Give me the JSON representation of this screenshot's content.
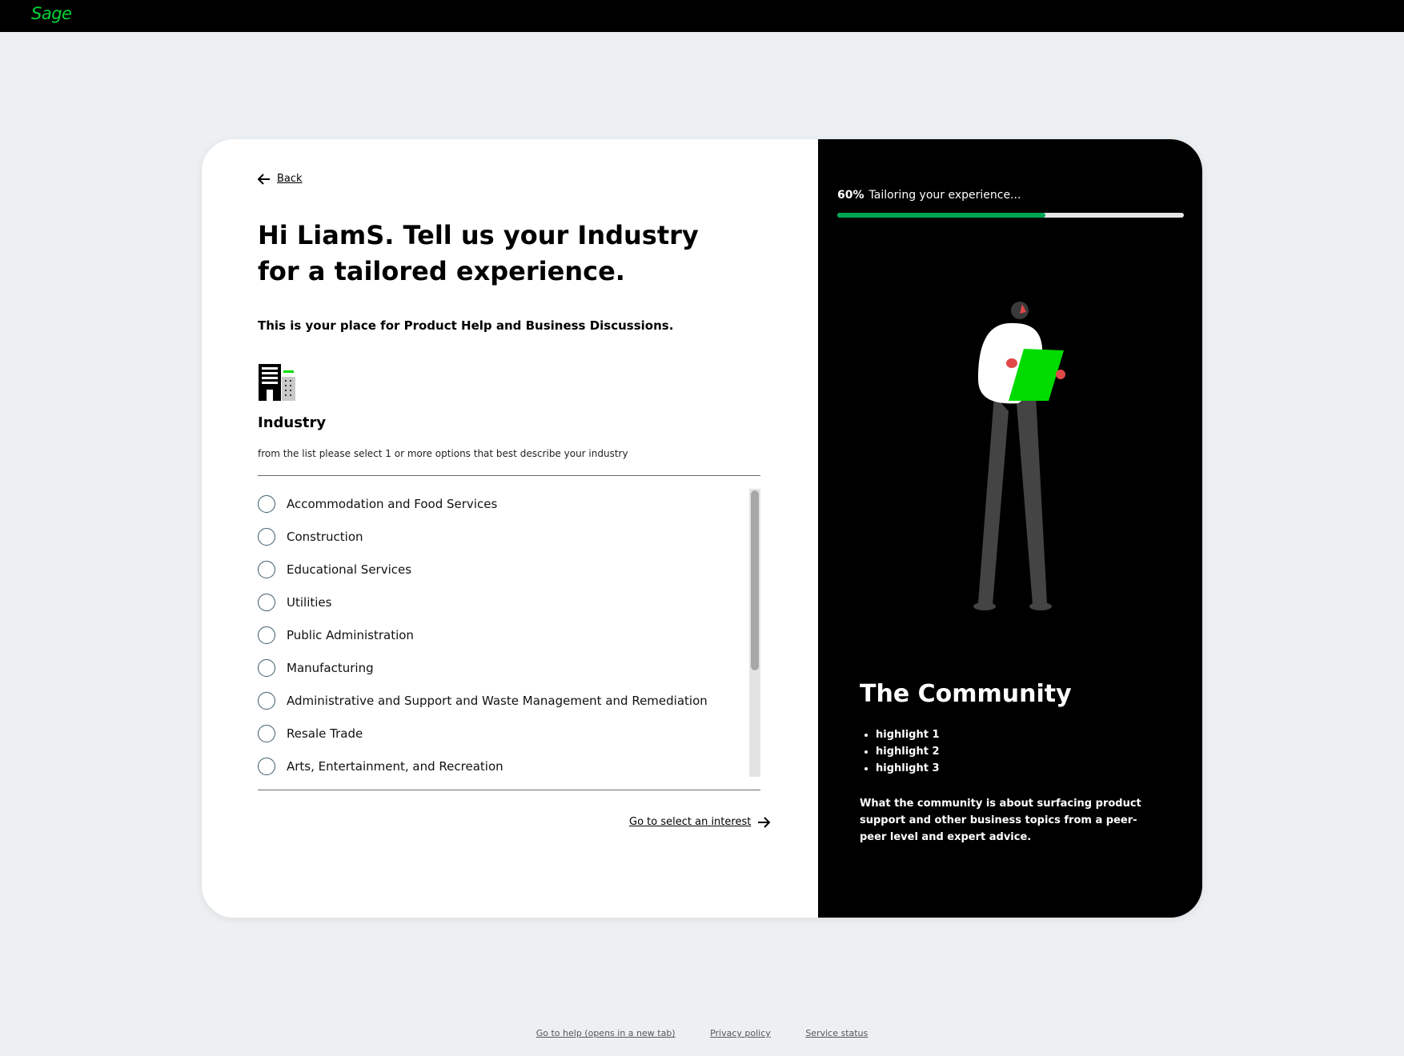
{
  "header": {
    "logo_text": "Sage"
  },
  "form": {
    "back_label": "Back",
    "headline": "Hi LiamS. Tell us your Industry for a tailored experience.",
    "subheading": "This is your place for Product Help and Business Discussions.",
    "section_icon": "building-icon",
    "section_title": "Industry",
    "section_description": "from the list please select 1 or more options that best describe your industry",
    "options": [
      "Accommodation and Food Services",
      "Construction",
      "Educational Services",
      "Utilities",
      "Public Administration",
      "Manufacturing",
      "Administrative and Support and Waste Management and Remediation",
      "Resale Trade",
      "Arts, Entertainment, and Recreation"
    ],
    "next_label": "Go to select an interest"
  },
  "sidebar": {
    "progress_percent": 60,
    "progress_label": "60%",
    "progress_text": "Tailoring your experience...",
    "title": "The Community",
    "highlights": [
      "highlight 1",
      "highlight 2",
      "highlight 3"
    ],
    "description": "What the community is about surfacing product support and other business topics from a peer-peer level and expert advice."
  },
  "footer": {
    "links": [
      "Go to help (opens in a new tab)",
      "Privacy policy",
      "Service status"
    ]
  },
  "colors": {
    "brand_green": "#00d639",
    "progress_green": "#00a651",
    "illustration_green": "#00dc00"
  }
}
